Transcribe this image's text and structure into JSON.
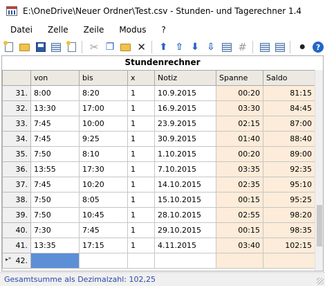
{
  "window": {
    "title": "E:\\OneDrive\\Neuer Ordner\\Test.csv - Stunden- und Tagerechner 1.4"
  },
  "menu": [
    {
      "label": "Datei"
    },
    {
      "label": "Zelle"
    },
    {
      "label": "Zeile"
    },
    {
      "label": "Modus"
    },
    {
      "label": "?"
    }
  ],
  "toolbar": {
    "icons": [
      "new-file-icon",
      "open-folder-icon",
      "save-icon",
      "save-as-icon",
      "print-preview-icon",
      "cut-icon",
      "copy-icon",
      "paste-icon",
      "delete-icon",
      "move-up-icon",
      "move-top-icon",
      "move-down-icon",
      "move-bottom-icon",
      "calendar-icon",
      "number-format-icon",
      "insert-row-icon",
      "delete-row-icon",
      "settings-icon",
      "help-icon"
    ]
  },
  "panel": {
    "title": "Stundenrechner"
  },
  "table": {
    "columns": [
      "",
      "von",
      "bis",
      "x",
      "Notiz",
      "Spanne",
      "Saldo"
    ],
    "rows": [
      {
        "num": "31.",
        "von": "8:00",
        "bis": "8:20",
        "x": "1",
        "notiz": "10.9.2015",
        "spanne": "00:20",
        "saldo": "81:15"
      },
      {
        "num": "32.",
        "von": "13:30",
        "bis": "17:00",
        "x": "1",
        "notiz": "16.9.2015",
        "spanne": "03:30",
        "saldo": "84:45"
      },
      {
        "num": "33.",
        "von": "7:45",
        "bis": "10:00",
        "x": "1",
        "notiz": "23.9.2015",
        "spanne": "02:15",
        "saldo": "87:00"
      },
      {
        "num": "34.",
        "von": "7:45",
        "bis": "9:25",
        "x": "1",
        "notiz": "30.9.2015",
        "spanne": "01:40",
        "saldo": "88:40"
      },
      {
        "num": "35.",
        "von": "7:50",
        "bis": "8:10",
        "x": "1",
        "notiz": "1.10.2015",
        "spanne": "00:20",
        "saldo": "89:00"
      },
      {
        "num": "36.",
        "von": "13:55",
        "bis": "17:30",
        "x": "1",
        "notiz": "7.10.2015",
        "spanne": "03:35",
        "saldo": "92:35"
      },
      {
        "num": "37.",
        "von": "7:45",
        "bis": "10:20",
        "x": "1",
        "notiz": "14.10.2015",
        "spanne": "02:35",
        "saldo": "95:10"
      },
      {
        "num": "38.",
        "von": "7:50",
        "bis": "8:05",
        "x": "1",
        "notiz": "15.10.2015",
        "spanne": "00:15",
        "saldo": "95:25"
      },
      {
        "num": "39.",
        "von": "7:50",
        "bis": "10:45",
        "x": "1",
        "notiz": "28.10.2015",
        "spanne": "02:55",
        "saldo": "98:20"
      },
      {
        "num": "40.",
        "von": "7:30",
        "bis": "7:45",
        "x": "1",
        "notiz": "29.10.2015",
        "spanne": "00:15",
        "saldo": "98:35"
      },
      {
        "num": "41.",
        "von": "13:35",
        "bis": "17:15",
        "x": "1",
        "notiz": "4.11.2015",
        "spanne": "03:40",
        "saldo": "102:15"
      }
    ],
    "new_row": {
      "marker": "▸*",
      "num": "42."
    }
  },
  "status": {
    "text": "Gesamtsumme als Dezimalzahl: 102,25"
  },
  "colors": {
    "calc_bg": "#fcecd9",
    "selected_cell": "#5c8fd6",
    "status_text": "#2a4aa6"
  }
}
